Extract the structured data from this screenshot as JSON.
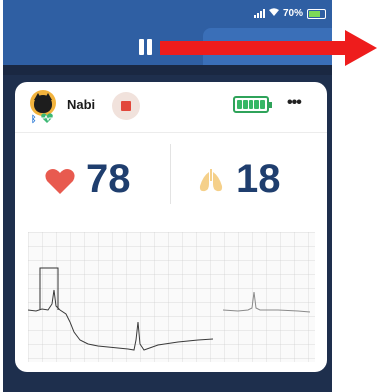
{
  "status_bar": {
    "battery_percent": "70%"
  },
  "patient": {
    "name": "Nabi"
  },
  "vitals": {
    "heart_rate": "78",
    "respiratory_rate": "18"
  },
  "colors": {
    "header": "#2f5fa3",
    "background": "#1e2f4d",
    "value_text": "#1f3e6e",
    "heart": "#e85a4f",
    "stop": "#e2463a",
    "battery": "#36b765",
    "arrow": "#ee1c1c"
  },
  "icons": [
    "signal-icon",
    "wifi-icon",
    "battery-icon",
    "pause-icon",
    "avatar",
    "bluetooth-icon",
    "heart-icon",
    "stop-icon",
    "device-battery-icon",
    "more-icon",
    "lungs-icon",
    "arrow-icon"
  ],
  "device_battery_bars": 5
}
